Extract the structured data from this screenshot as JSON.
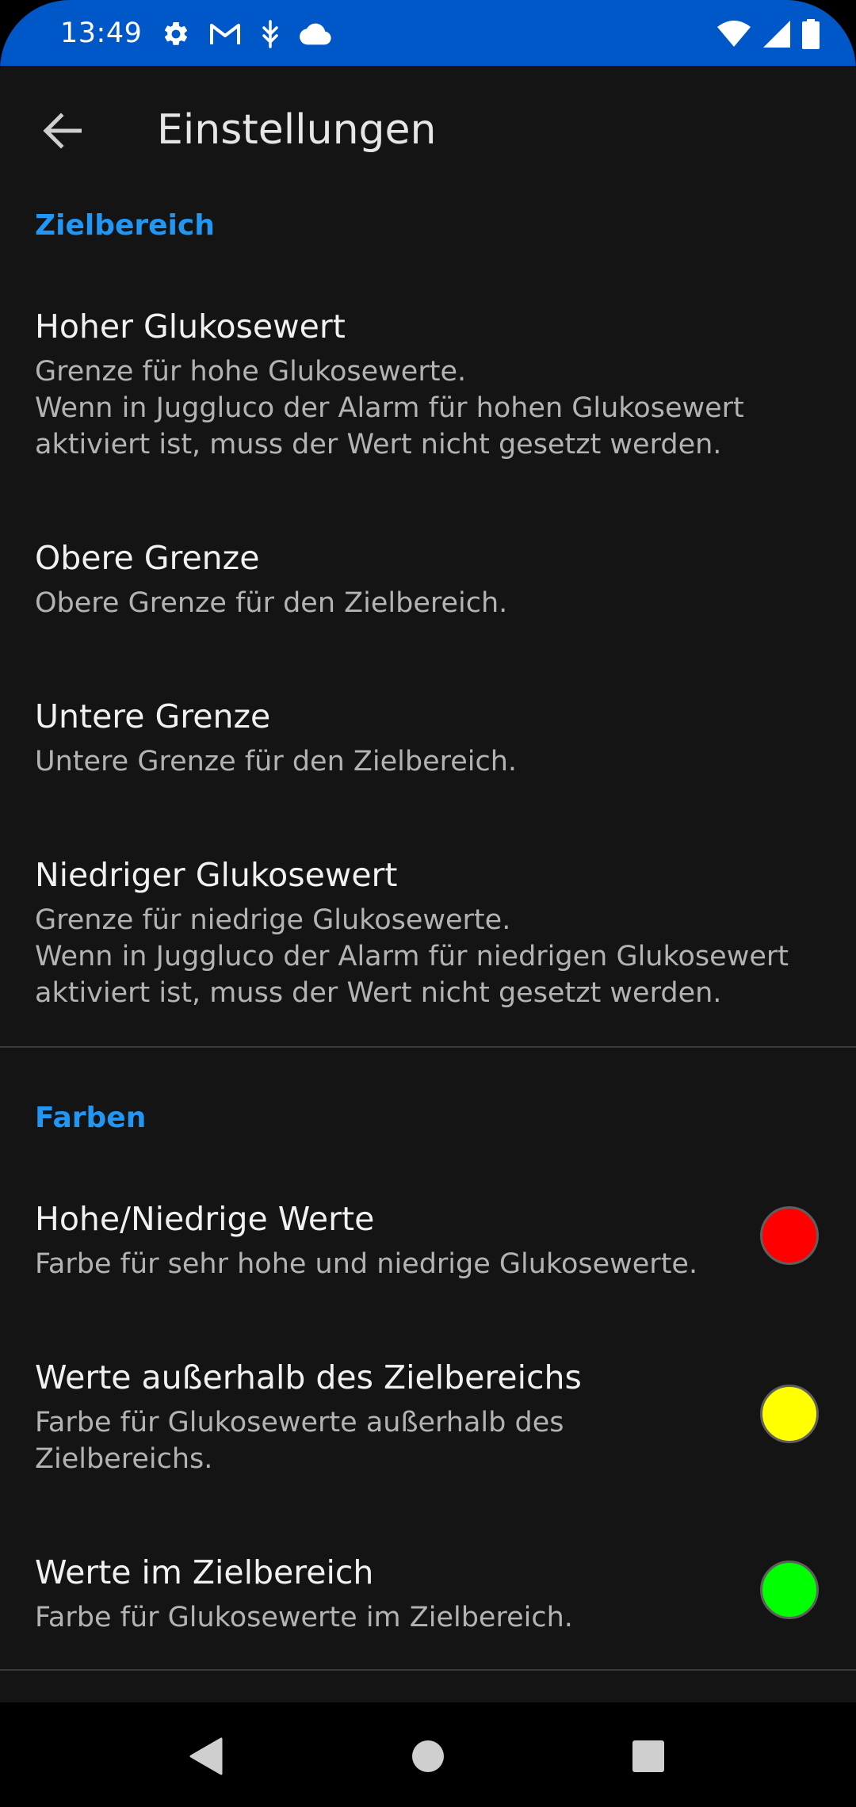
{
  "status_bar": {
    "time": "13:49",
    "left_icons": [
      "gear-icon",
      "gmail-icon",
      "usb-debug-icon",
      "cloud-icon"
    ],
    "right_icons": [
      "wifi-icon",
      "cell-signal-icon",
      "battery-icon"
    ],
    "background_color": "#0057c8"
  },
  "toolbar": {
    "title": "Einstellungen"
  },
  "sections": [
    {
      "title": "Zielbereich",
      "items": [
        {
          "title": "Hoher Glukosewert",
          "summary": "Grenze für hohe Glukosewerte.\nWenn in Juggluco der Alarm für hohen Glukosewert aktiviert ist, muss der Wert nicht gesetzt werden."
        },
        {
          "title": "Obere Grenze",
          "summary": "Obere Grenze für den Zielbereich."
        },
        {
          "title": "Untere Grenze",
          "summary": "Untere Grenze für den Zielbereich."
        },
        {
          "title": "Niedriger Glukosewert",
          "summary": "Grenze für niedrige Glukosewerte.\nWenn in Juggluco der Alarm für niedrigen Glukosewert aktiviert ist, muss der Wert nicht gesetzt werden."
        }
      ]
    },
    {
      "title": "Farben",
      "items": [
        {
          "title": "Hohe/Niedrige Werte",
          "summary": "Farbe für sehr hohe und niedrige Glukosewerte.",
          "color": "#ff0000"
        },
        {
          "title": "Werte außerhalb des Zielbereichs",
          "summary": "Farbe für Glukosewerte außerhalb des\nZielbereichs.",
          "color": "#ffff00"
        },
        {
          "title": "Werte im Zielbereich",
          "summary": "Farbe für Glukosewerte im Zielbereich.",
          "color": "#00ff00"
        }
      ]
    }
  ],
  "theme": {
    "accent": "#2196f3",
    "background": "#141414"
  }
}
